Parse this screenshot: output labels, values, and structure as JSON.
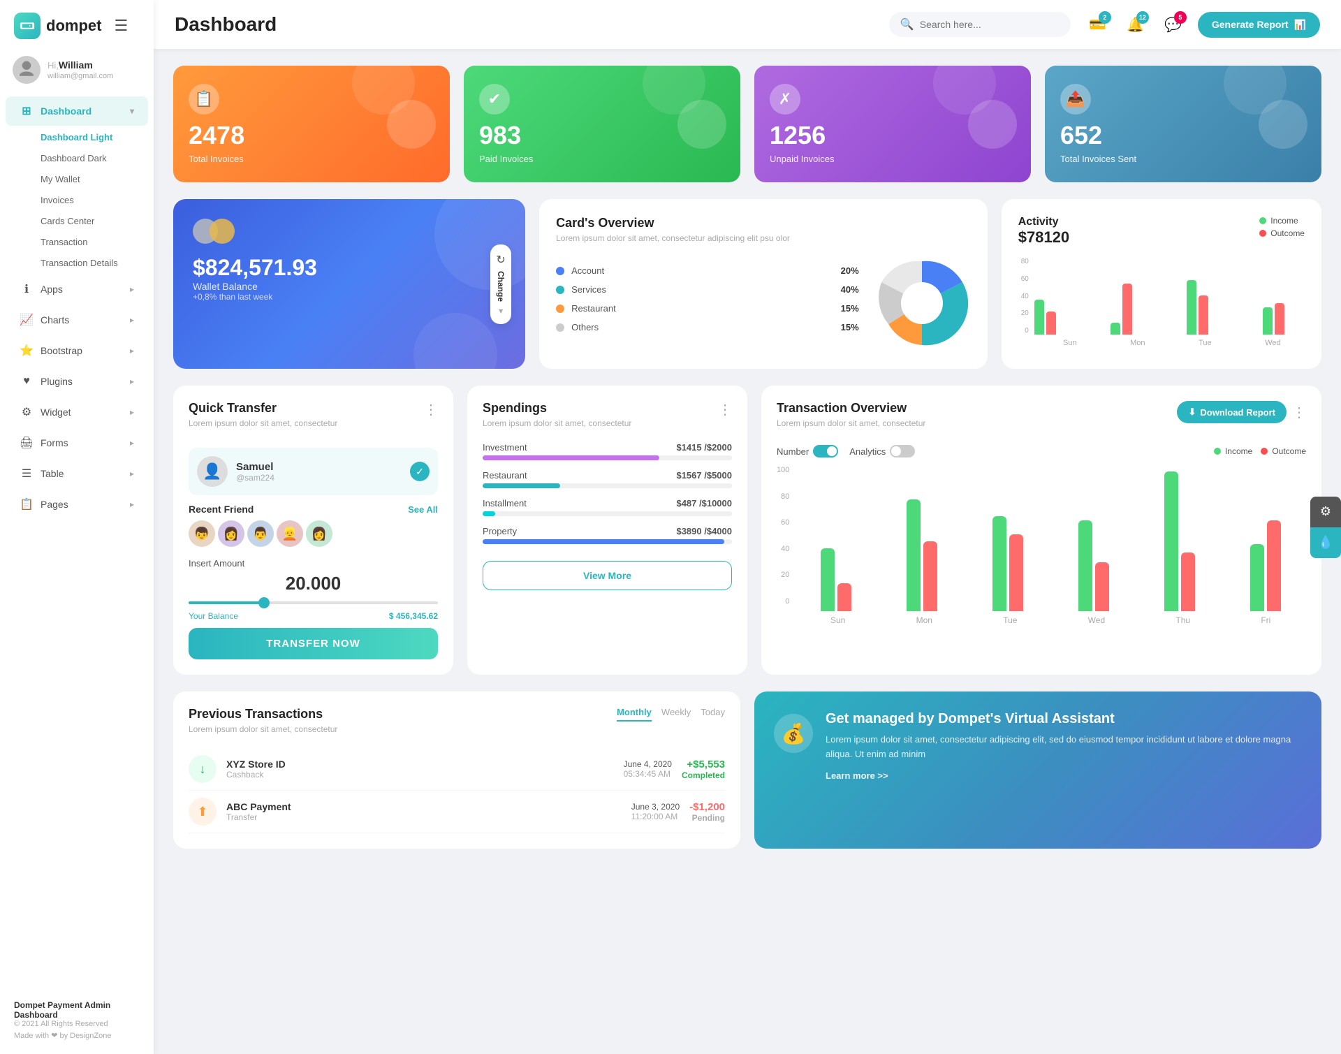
{
  "app": {
    "logo_text": "dompet",
    "page_title": "Dashboard"
  },
  "topbar": {
    "search_placeholder": "Search here...",
    "badge_wallet": "2",
    "badge_bell": "12",
    "badge_chat": "5",
    "generate_btn": "Generate Report"
  },
  "user": {
    "greeting": "Hi,",
    "name": "William",
    "email": "william@gmail.com"
  },
  "sidebar": {
    "dashboard_label": "Dashboard",
    "sub_items": [
      "Dashboard Light",
      "Dashboard Dark",
      "My Wallet",
      "Invoices",
      "Cards Center",
      "Transaction",
      "Transaction Details"
    ],
    "nav_items": [
      {
        "label": "Apps",
        "icon": "ℹ"
      },
      {
        "label": "Charts",
        "icon": "📈"
      },
      {
        "label": "Bootstrap",
        "icon": "⭐"
      },
      {
        "label": "Plugins",
        "icon": "❤"
      },
      {
        "label": "Widget",
        "icon": "⚙"
      },
      {
        "label": "Forms",
        "icon": "🖨"
      },
      {
        "label": "Table",
        "icon": "☰"
      },
      {
        "label": "Pages",
        "icon": "🗒"
      }
    ],
    "footer_brand": "Dompet Payment Admin Dashboard",
    "footer_copy": "© 2021 All Rights Reserved",
    "footer_made": "Made with ❤ by DesignZone"
  },
  "stat_cards": [
    {
      "number": "2478",
      "label": "Total Invoices",
      "color": "orange"
    },
    {
      "number": "983",
      "label": "Paid Invoices",
      "color": "green"
    },
    {
      "number": "1256",
      "label": "Unpaid Invoices",
      "color": "purple"
    },
    {
      "number": "652",
      "label": "Total Invoices Sent",
      "color": "teal"
    }
  ],
  "wallet_card": {
    "balance_label": "Wallet Balance",
    "amount": "$824,571.93",
    "change": "+0,8% than last week"
  },
  "cards_overview": {
    "title": "Card's Overview",
    "subtitle": "Lorem ipsum dolor sit amet, consectetur adipiscing elit psu olor",
    "items": [
      {
        "label": "Account",
        "pct": "20%",
        "color": "blue"
      },
      {
        "label": "Services",
        "pct": "40%",
        "color": "teal"
      },
      {
        "label": "Restaurant",
        "pct": "15%",
        "color": "orange"
      },
      {
        "label": "Others",
        "pct": "15%",
        "color": "gray"
      }
    ]
  },
  "activity": {
    "title": "Activity",
    "amount": "$78120",
    "income_label": "Income",
    "outcome_label": "Outcome",
    "bars": [
      {
        "label": "Sun",
        "green": 45,
        "red": 30
      },
      {
        "label": "Mon",
        "green": 15,
        "red": 65
      },
      {
        "label": "Tue",
        "green": 70,
        "red": 50
      },
      {
        "label": "Wed",
        "green": 35,
        "red": 40
      }
    ]
  },
  "quick_transfer": {
    "title": "Quick Transfer",
    "subtitle": "Lorem ipsum dolor sit amet, consectetur",
    "user_name": "Samuel",
    "user_handle": "@sam224",
    "recent_friend_label": "Recent Friend",
    "see_all": "See All",
    "amount_label": "Insert Amount",
    "amount": "20.000",
    "balance_label": "Your Balance",
    "balance": "$ 456,345.62",
    "transfer_btn": "TRANSFER NOW"
  },
  "spendings": {
    "title": "Spendings",
    "subtitle": "Lorem ipsum dolor sit amet, consectetur",
    "items": [
      {
        "label": "Investment",
        "amount": "$1415",
        "total": "$2000",
        "pct": 71,
        "color": "purple"
      },
      {
        "label": "Restaurant",
        "amount": "$1567",
        "total": "$5000",
        "pct": 31,
        "color": "teal"
      },
      {
        "label": "Installment",
        "amount": "$487",
        "total": "$10000",
        "pct": 5,
        "color": "cyan"
      },
      {
        "label": "Property",
        "amount": "$3890",
        "total": "$4000",
        "pct": 97,
        "color": "blue"
      }
    ],
    "view_more": "View More"
  },
  "transaction_overview": {
    "title": "Transaction Overview",
    "subtitle": "Lorem ipsum dolor sit amet, consectetur",
    "download_btn": "Download Report",
    "number_label": "Number",
    "analytics_label": "Analytics",
    "income_label": "Income",
    "outcome_label": "Outcome",
    "bars": [
      {
        "label": "Sun",
        "green": 45,
        "red": 20
      },
      {
        "label": "Mon",
        "green": 80,
        "red": 50
      },
      {
        "label": "Tue",
        "green": 68,
        "red": 55
      },
      {
        "label": "Wed",
        "green": 65,
        "red": 35
      },
      {
        "label": "Thu",
        "green": 100,
        "red": 42
      },
      {
        "label": "Fri",
        "green": 48,
        "red": 65
      }
    ]
  },
  "prev_transactions": {
    "title": "Previous Transactions",
    "subtitle": "Lorem ipsum dolor sit amet, consectetur",
    "tabs": [
      "Monthly",
      "Weekly",
      "Today"
    ],
    "active_tab": "Monthly",
    "items": [
      {
        "icon": "↓",
        "name": "XYZ Store ID",
        "meta": "Cashback",
        "date": "June 4, 2020",
        "time": "05:34:45 AM",
        "amount": "+$5,553",
        "status": "Completed"
      },
      {
        "icon": "⬆",
        "name": "ABC Payment",
        "meta": "Transfer",
        "date": "June 3, 2020",
        "time": "11:20:00 AM",
        "amount": "-$1,200",
        "status": "Pending"
      }
    ]
  },
  "assistant": {
    "title": "Get managed by Dompet's Virtual Assistant",
    "desc": "Lorem ipsum dolor sit amet, consectetur adipiscing elit, sed do eiusmod tempor incididunt ut labore et dolore magna aliqua. Ut enim ad minim",
    "learn_more": "Learn more >>"
  }
}
